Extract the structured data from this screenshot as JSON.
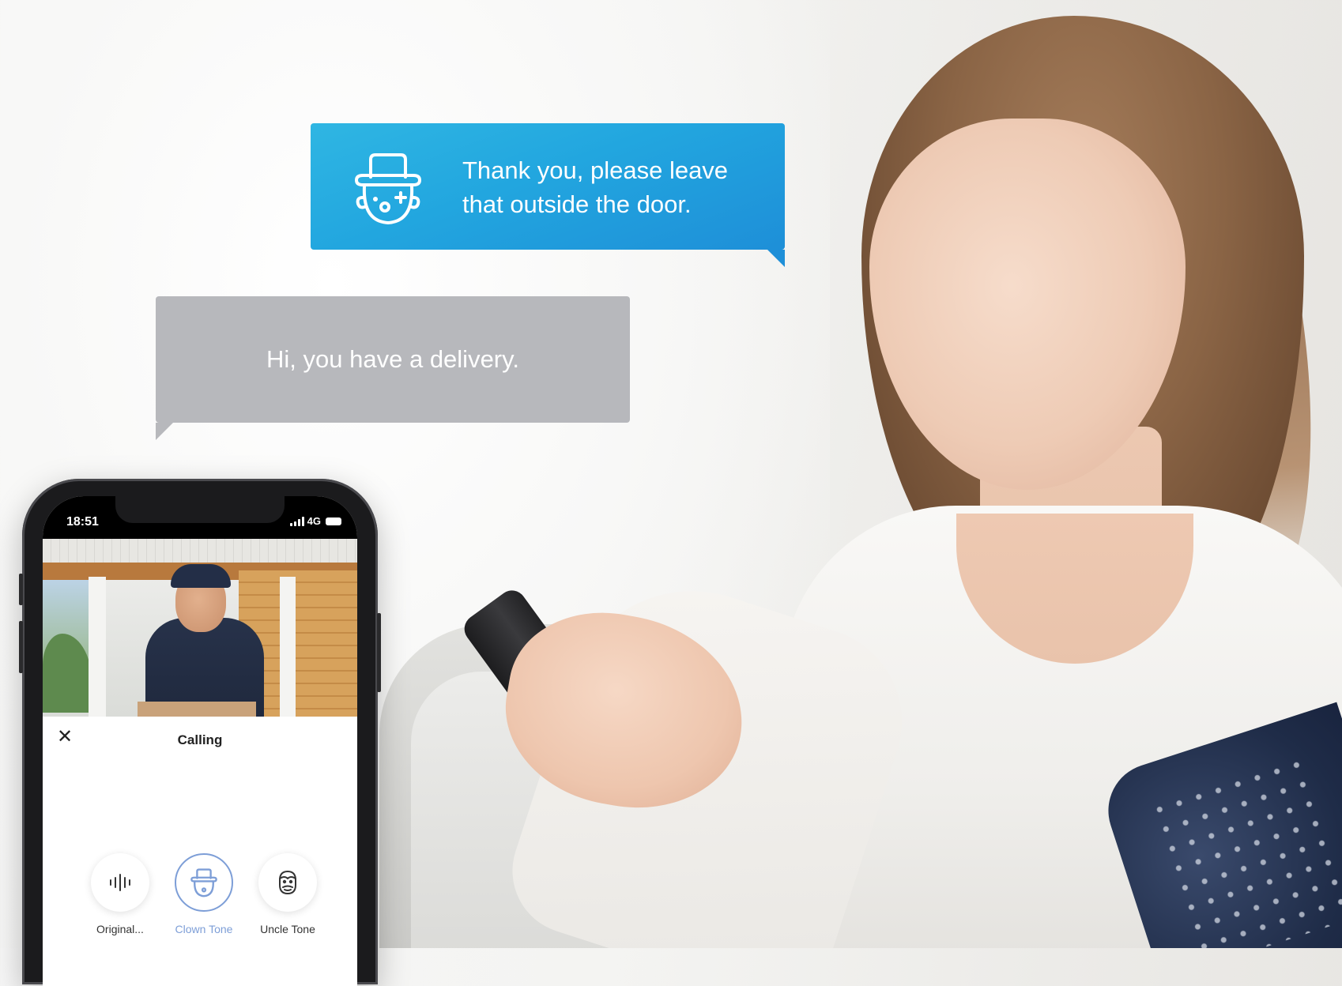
{
  "messages": {
    "reply": "Thank you, please leave that outside the door.",
    "visitor": "Hi, you have a delivery."
  },
  "phone": {
    "time": "18:51",
    "network": "4G",
    "calling_title": "Calling",
    "tones": [
      {
        "label": "Original...",
        "icon": "sound-wave-icon",
        "selected": false
      },
      {
        "label": "Clown Tone",
        "icon": "clown-face-icon",
        "selected": true
      },
      {
        "label": "Uncle Tone",
        "icon": "uncle-face-icon",
        "selected": false
      }
    ]
  },
  "colors": {
    "reply_bubble": "#22a6df",
    "visitor_bubble": "#b7b8bc",
    "selected_tone": "#7d9ed7"
  }
}
